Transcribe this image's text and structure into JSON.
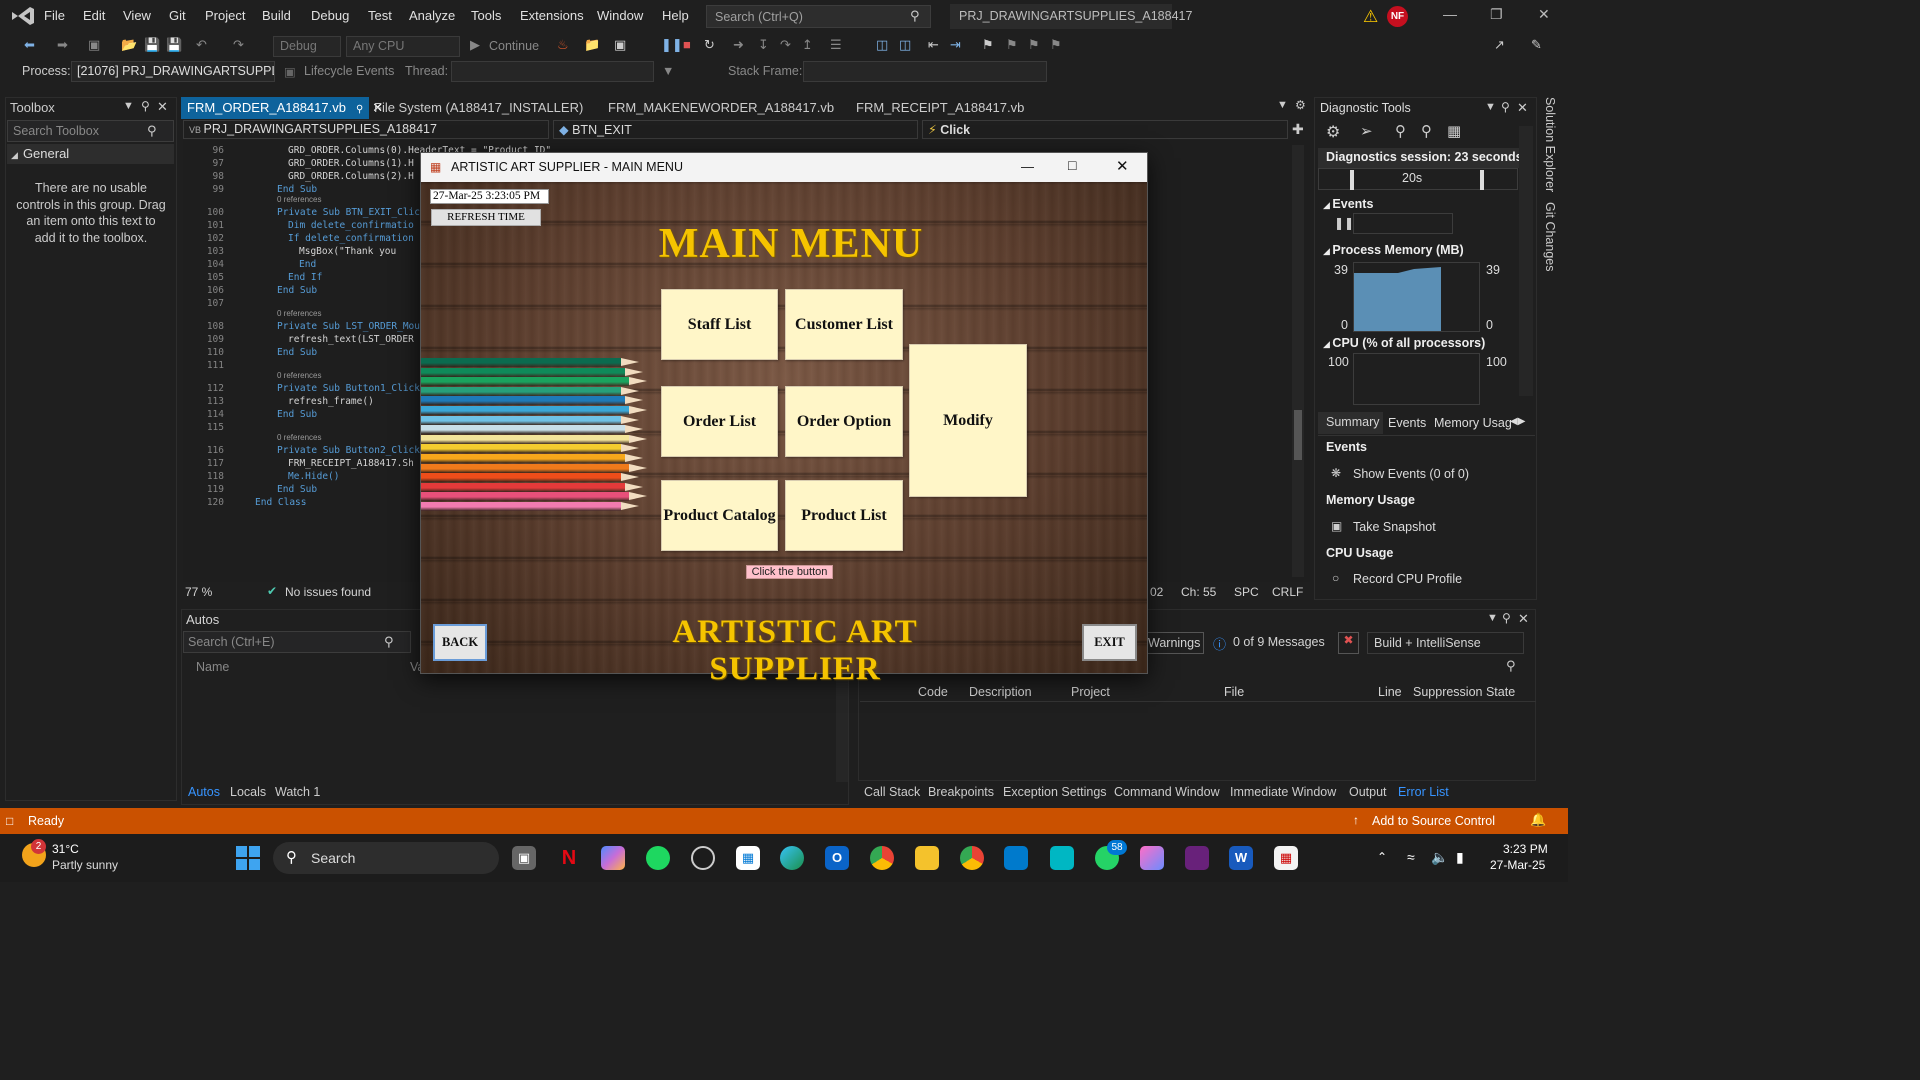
{
  "menu": [
    "File",
    "Edit",
    "View",
    "Git",
    "Project",
    "Build",
    "Debug",
    "Test",
    "Analyze",
    "Tools",
    "Extensions",
    "Window",
    "Help"
  ],
  "search": {
    "placeholder": "Search (Ctrl+Q)"
  },
  "project_title": "PRJ_DRAWINGARTSUPPLIES_A188417",
  "user_initials": "NF",
  "toolbar": {
    "config": "Debug",
    "platform": "Any CPU",
    "continue_label": "Continue"
  },
  "processbar": {
    "process_label": "Process:",
    "process_value": "[21076] PRJ_DRAWINGARTSUPPLIE",
    "lifecycle": "Lifecycle Events",
    "thread_label": "Thread:",
    "stackframe_label": "Stack Frame:"
  },
  "toolbox": {
    "title": "Toolbox",
    "search_placeholder": "Search Toolbox",
    "group": "General",
    "empty_text": "There are no usable controls in this group. Drag an item onto this text to add it to the toolbox."
  },
  "tabs": [
    "FRM_ORDER_A188417.vb",
    "File System (A188417_INSTALLER)",
    "FRM_MAKENEWORDER_A188417.vb",
    "FRM_RECEIPT_A188417.vb"
  ],
  "nav": {
    "project": "PRJ_DRAWINGARTSUPPLIES_A188417",
    "member": "BTN_EXIT",
    "event": "Click"
  },
  "code": [
    {
      "n": "96",
      "t": "GRD_ORDER.Columns(0).HeaderText = \"Product ID\"",
      "indent": 3
    },
    {
      "n": "97",
      "t": "GRD_ORDER.Columns(1).H",
      "indent": 3
    },
    {
      "n": "98",
      "t": "GRD_ORDER.Columns(2).H",
      "indent": 3
    },
    {
      "n": "99",
      "t": "End Sub",
      "indent": 2
    },
    {
      "n": "100",
      "t": "Private Sub BTN_EXIT_Click",
      "indent": 2,
      "refs": "0 references"
    },
    {
      "n": "101",
      "t": "Dim delete_confirmatio",
      "indent": 3
    },
    {
      "n": "102",
      "t": "If delete_confirmation",
      "indent": 3
    },
    {
      "n": "103",
      "t": "MsgBox(\"Thank you",
      "indent": 4
    },
    {
      "n": "104",
      "t": "End",
      "indent": 4
    },
    {
      "n": "105",
      "t": "End If",
      "indent": 3
    },
    {
      "n": "106",
      "t": "End Sub",
      "indent": 2
    },
    {
      "n": "107",
      "t": "",
      "indent": 0
    },
    {
      "n": "108",
      "t": "Private Sub LST_ORDER_Mous",
      "indent": 2,
      "refs": "0 references"
    },
    {
      "n": "109",
      "t": "refresh_text(LST_ORDER",
      "indent": 3
    },
    {
      "n": "110",
      "t": "End Sub",
      "indent": 2
    },
    {
      "n": "111",
      "t": "",
      "indent": 0
    },
    {
      "n": "112",
      "t": "Private Sub Button1_Click(",
      "indent": 2,
      "refs": "0 references"
    },
    {
      "n": "113",
      "t": "refresh_frame()",
      "indent": 3
    },
    {
      "n": "114",
      "t": "End Sub",
      "indent": 2
    },
    {
      "n": "115",
      "t": "",
      "indent": 0
    },
    {
      "n": "116",
      "t": "Private Sub Button2_Click(",
      "indent": 2,
      "refs": "0 references"
    },
    {
      "n": "117",
      "t": "FRM_RECEIPT_A188417.Sh",
      "indent": 3
    },
    {
      "n": "118",
      "t": "Me.Hide()",
      "indent": 3
    },
    {
      "n": "119",
      "t": "End Sub",
      "indent": 2
    },
    {
      "n": "120",
      "t": "End Class",
      "indent": 0
    }
  ],
  "editor_status": {
    "zoom": "77 %",
    "issues": "No issues found",
    "line": "02",
    "col": "Ch: 55",
    "spc": "SPC",
    "crlf": "CRLF"
  },
  "autos": {
    "title": "Autos",
    "search_placeholder": "Search (Ctrl+E)",
    "col_name": "Name",
    "col_value": "Va"
  },
  "bottom_tabs_left": [
    "Autos",
    "Locals",
    "Watch 1"
  ],
  "errlist": {
    "warnings": "Warnings",
    "messages": "0 of 9 Messages",
    "scope": "Build + IntelliSense",
    "cols": [
      "Code",
      "Description",
      "Project",
      "File",
      "Line",
      "Suppression State"
    ]
  },
  "bottom_tabs_right": [
    "Call Stack",
    "Breakpoints",
    "Exception Settings",
    "Command Window",
    "Immediate Window",
    "Output",
    "Error List"
  ],
  "diag": {
    "title": "Diagnostic Tools",
    "session": "Diagnostics session: 23 seconds",
    "timeline": "20s",
    "events": "Events",
    "memory": "Process Memory (MB)",
    "mem_max": "39",
    "mem_min": "0",
    "cpu": "CPU (% of all processors)",
    "cpu_max": "100",
    "tabs": [
      "Summary",
      "Events",
      "Memory Usag"
    ],
    "events_hdr": "Events",
    "show_events": "Show Events (0 of 0)",
    "memusage_hdr": "Memory Usage",
    "take_snapshot": "Take Snapshot",
    "cpu_hdr": "CPU Usage",
    "record_cpu": "Record CPU Profile"
  },
  "side_labels": [
    "Solution Explorer",
    "Git Changes"
  ],
  "statusbar": {
    "ready": "Ready",
    "source_control": "Add to Source Control"
  },
  "taskbar": {
    "weather_temp": "31°C",
    "weather_desc": "Partly sunny",
    "weather_badge": "2",
    "search": "Search",
    "whatsapp_badge": "58",
    "time": "3:23 PM",
    "date": "27-Mar-25"
  },
  "form": {
    "title": "ARTISTIC ART SUPPLIER - MAIN MENU",
    "datetime": "27-Mar-25 3:23:05 PM",
    "refresh": "REFRESH TIME",
    "heading": "MAIN MENU",
    "buttons": {
      "staff": "Staff List",
      "customer": "Customer List",
      "order": "Order List",
      "order_option": "Order Option",
      "modify": "Modify",
      "catalog": "Product Catalog",
      "product": "Product List"
    },
    "hint": "Click the button",
    "back": "BACK",
    "exit": "EXIT",
    "footer": "ARTISTIC ART SUPPLIER"
  },
  "colors": {
    "accent": "#0e639c",
    "status": "#ca5100",
    "gold": "#f5c400",
    "cream": "#fff6c8"
  }
}
